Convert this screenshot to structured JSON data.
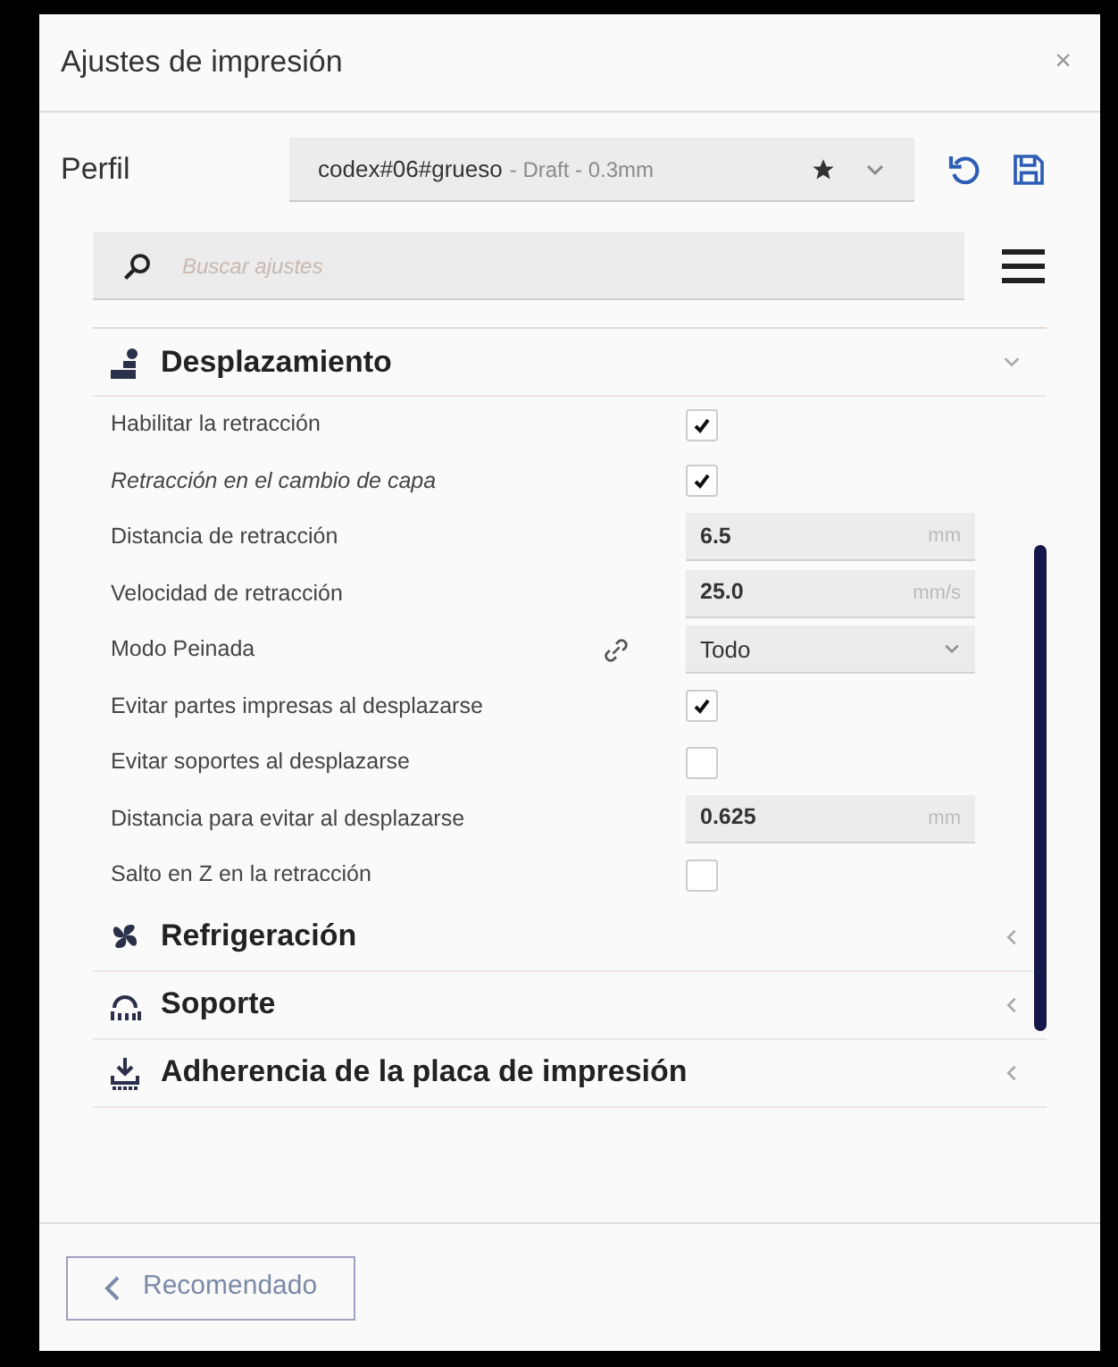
{
  "window": {
    "title": "Ajustes de impresión",
    "close": "×"
  },
  "profile": {
    "label": "Perfil",
    "name": "codex#06#grueso",
    "detail": "- Draft - 0.3mm"
  },
  "search": {
    "placeholder": "Buscar ajustes"
  },
  "sections": [
    {
      "title": "Desplazamiento",
      "expanded": true,
      "settings": [
        {
          "kind": "checkbox",
          "label": "Habilitar la retracción",
          "italic": false,
          "checked": true
        },
        {
          "kind": "checkbox",
          "label": "Retracción en el cambio de capa",
          "italic": true,
          "checked": true
        },
        {
          "kind": "number",
          "label": "Distancia de retracción",
          "italic": false,
          "value": "6.5",
          "unit": "mm"
        },
        {
          "kind": "number",
          "label": "Velocidad de retracción",
          "italic": false,
          "value": "25.0",
          "unit": "mm/s"
        },
        {
          "kind": "select",
          "label": "Modo Peinada",
          "italic": false,
          "value": "Todo",
          "linked": true
        },
        {
          "kind": "checkbox",
          "label": "Evitar partes impresas al desplazarse",
          "italic": false,
          "checked": true
        },
        {
          "kind": "checkbox",
          "label": "Evitar soportes al desplazarse",
          "italic": false,
          "checked": false
        },
        {
          "kind": "number",
          "label": "Distancia para evitar al desplazarse",
          "italic": false,
          "value": "0.625",
          "unit": "mm"
        },
        {
          "kind": "checkbox",
          "label": "Salto en Z en la retracción",
          "italic": false,
          "checked": false
        }
      ]
    },
    {
      "title": "Refrigeración",
      "expanded": false
    },
    {
      "title": "Soporte",
      "expanded": false
    },
    {
      "title": "Adherencia de la placa de impresión",
      "expanded": false
    }
  ],
  "footer": {
    "button": "Recomendado"
  }
}
